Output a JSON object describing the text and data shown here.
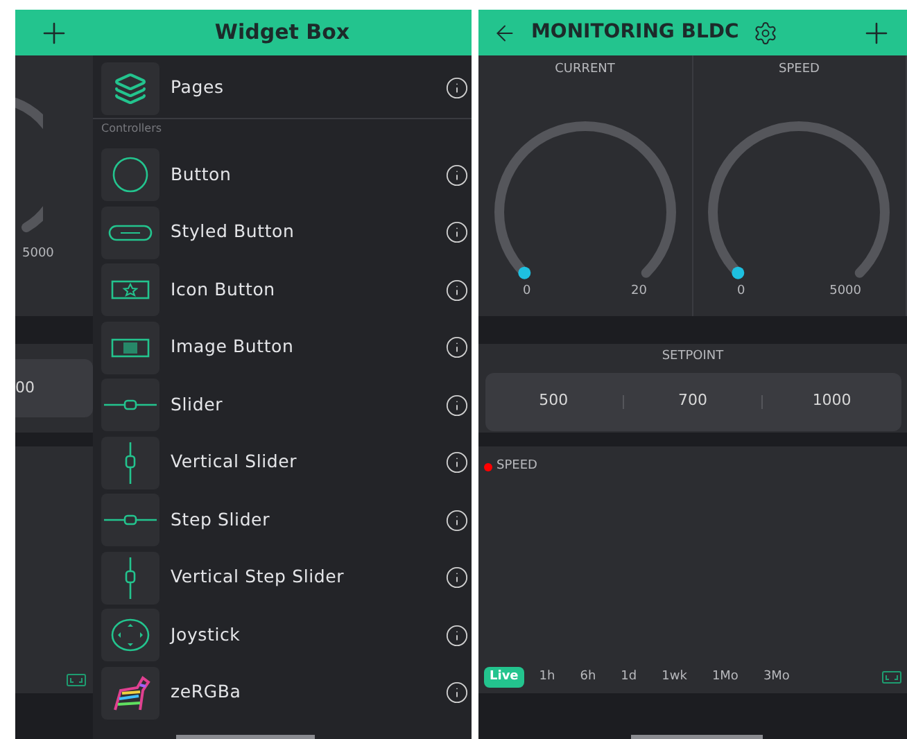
{
  "background_screen": {
    "gauge_max": "5000",
    "setpoint_value": "00"
  },
  "widget_box": {
    "title": "Widget Box",
    "top_items": [
      {
        "label": "Pages",
        "kind": "pages"
      }
    ],
    "section": "Controllers",
    "items": [
      {
        "label": "Button",
        "kind": "button"
      },
      {
        "label": "Styled Button",
        "kind": "styled_button"
      },
      {
        "label": "Icon Button",
        "kind": "icon_button"
      },
      {
        "label": "Image Button",
        "kind": "image_button"
      },
      {
        "label": "Slider",
        "kind": "slider"
      },
      {
        "label": "Vertical Slider",
        "kind": "vertical_slider"
      },
      {
        "label": "Step Slider",
        "kind": "slider"
      },
      {
        "label": "Vertical Step Slider",
        "kind": "vertical_slider"
      },
      {
        "label": "Joystick",
        "kind": "joystick"
      },
      {
        "label": "zeRGBa",
        "kind": "zergba"
      }
    ]
  },
  "dashboard": {
    "title": "MONITORING BLDC",
    "gauges": [
      {
        "label": "CURRENT",
        "min": "0",
        "max": "20"
      },
      {
        "label": "SPEED",
        "min": "0",
        "max": "5000"
      }
    ],
    "setpoint": {
      "label": "SETPOINT",
      "options": [
        "500",
        "700",
        "1000"
      ]
    },
    "chart": {
      "legend": [
        {
          "label": "SPEED",
          "color": "#ff0000"
        }
      ],
      "ranges": [
        {
          "label": "Live",
          "selected": true
        },
        {
          "label": "1h",
          "selected": false
        },
        {
          "label": "6h",
          "selected": false
        },
        {
          "label": "1d",
          "selected": false
        },
        {
          "label": "1wk",
          "selected": false
        },
        {
          "label": "1Mo",
          "selected": false
        },
        {
          "label": "3Mo",
          "selected": false
        }
      ]
    }
  }
}
